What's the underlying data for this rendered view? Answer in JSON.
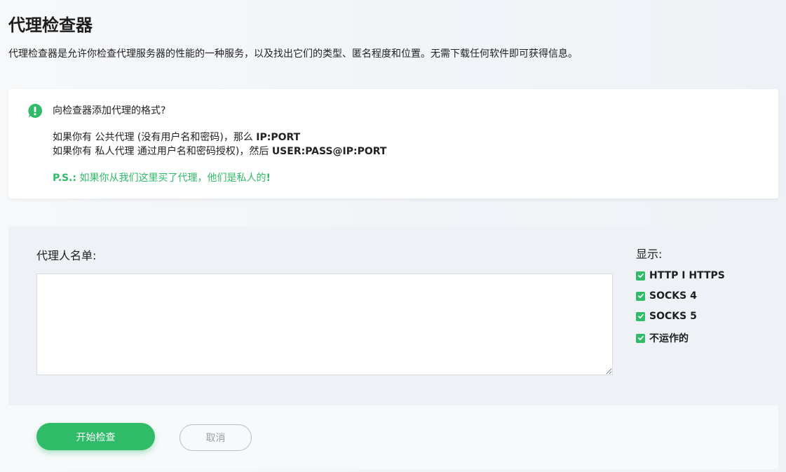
{
  "page": {
    "title": "代理检查器",
    "subtitle": "代理检查器是允许你检查代理服务器的性能的一种服务，以及找出它们的类型、匿名程度和位置。无需下载任何软件即可获得信息。"
  },
  "info": {
    "icon": "exclamation-icon",
    "title": "向检查器添加代理的格式?",
    "public_prefix": "如果你有 公共代理 (没有用户名和密码)，那么 ",
    "public_format": "IP:PORT",
    "private_prefix": "如果你有 私人代理 通过用户名和密码授权)，然后 ",
    "private_format": "USER:PASS@IP:PORT",
    "ps_label": "P.S.:",
    "ps_text": " 如果你从我们这里买了代理，他们是私人的",
    "ps_end": "!"
  },
  "form": {
    "list_label": "代理人名单:",
    "textarea_value": "",
    "show_label": "显示:",
    "filters": [
      {
        "label": "HTTP I HTTPS",
        "checked": true
      },
      {
        "label": "SOCKS 4",
        "checked": true
      },
      {
        "label": "SOCKS 5",
        "checked": true
      },
      {
        "label": "不运作的",
        "checked": true
      }
    ],
    "start_label": "开始检查",
    "cancel_label": "取消"
  },
  "colors": {
    "accent": "#2fbb68",
    "text": "#222222",
    "panel": "#eef1f5"
  }
}
